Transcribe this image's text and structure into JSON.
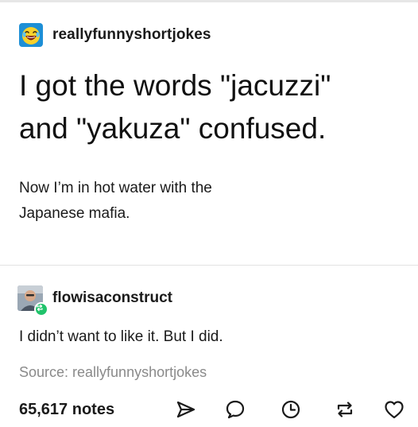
{
  "post": {
    "author": "reallyfunnyshortjokes",
    "author_avatar_icon": "laughing-emoji-icon",
    "headline_line1": "I got the words \"jacuzzi\"",
    "headline_line2": "and \"yakuza\" confused.",
    "body_line1": "Now I’m in hot water with the",
    "body_line2": "Japanese mafia."
  },
  "reblog": {
    "author": "flowisaconstruct",
    "comment": "I didn’t want to like it. But I did.",
    "source_label": "Source: reallyfunnyshortjokes"
  },
  "footer": {
    "notes": "65,617 notes",
    "actions": [
      "share-icon",
      "reply-icon",
      "queue-icon",
      "reblog-icon",
      "like-icon"
    ]
  },
  "colors": {
    "text": "#1a1a1a",
    "muted": "#8a8a8a",
    "divider": "#e3e3e3",
    "reblog_green": "#21c36b",
    "avatar_blue": "#1d8fd6",
    "emoji_yellow": "#f7d12c"
  }
}
